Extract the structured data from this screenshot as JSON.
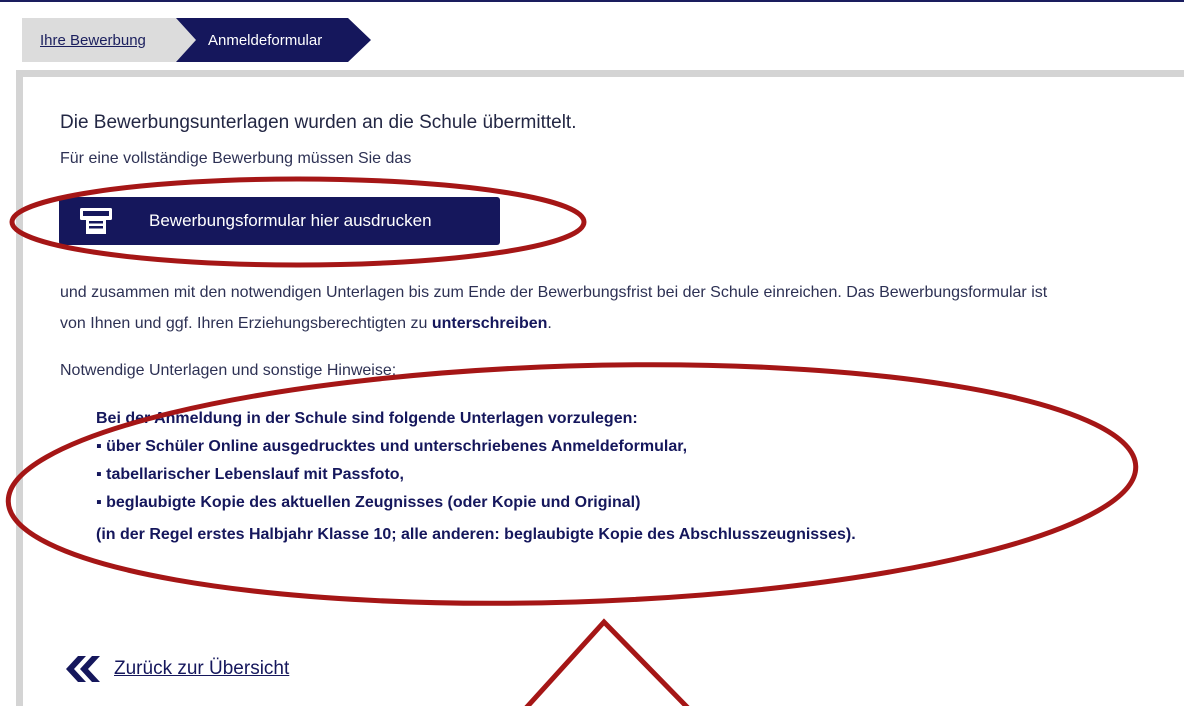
{
  "breadcrumb": {
    "items": [
      {
        "label": "Ihre Bewerbung"
      },
      {
        "label": "Anmeldeformular"
      }
    ]
  },
  "main": {
    "lead": "Die Bewerbungsunterlagen wurden an die Schule übermittelt.",
    "sub": "Für eine vollständige Bewerbung müssen Sie das",
    "print_button": {
      "label": "Bewerbungsformular hier ausdrucken",
      "icon": "printer-icon"
    },
    "paragraph_part1": "und zusammen mit den notwendigen Unterlagen bis zum Ende der Bewerbungsfrist bei der Schule einreichen. Das Bewerbungsformular ist von Ihnen und ggf. Ihren Erziehungsberechtigten zu ",
    "paragraph_bold": "unterschreiben",
    "paragraph_end": ".",
    "notes_label": "Notwendige Unterlagen und sonstige Hinweise:",
    "requirements": [
      "Bei der Anmeldung in der Schule sind folgende Unterlagen vorzulegen:",
      "▪ über Schüler Online ausgedrucktes und unterschriebenes Anmeldeformular,",
      "▪ tabellarischer Lebenslauf mit Passfoto,",
      "▪ beglaubigte Kopie des aktuellen Zeugnisses (oder Kopie und Original)",
      "(in der Regel erstes Halbjahr Klasse 10; alle anderen: beglaubigte Kopie des Abschlusszeugnisses)."
    ],
    "back_link": {
      "label": "Zurück zur Übersicht",
      "icon": "double-chevron-left-icon"
    }
  },
  "colors": {
    "navy": "#15175c",
    "text": "#2d3154",
    "annotation_red": "#a51616",
    "panel_border": "#d4d4d4"
  }
}
